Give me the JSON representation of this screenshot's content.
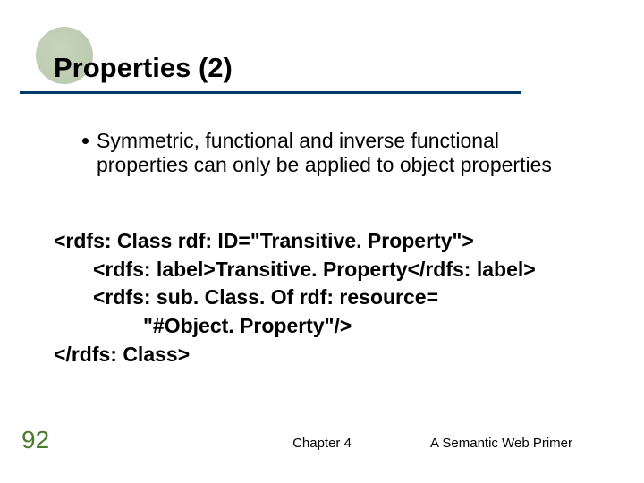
{
  "slide": {
    "title": "Properties (2)",
    "bullet": "Symmetric, functional and inverse functional properties can only be applied to object properties",
    "code": {
      "line1": "<rdfs: Class rdf: ID=\"Transitive. Property\">",
      "line2": "<rdfs: label>Transitive. Property</rdfs: label>",
      "line3": "<rdfs: sub. Class. Of rdf: resource=",
      "line4": "\"#Object. Property\"/>",
      "line5": "</rdfs: Class>"
    },
    "page_number": "92",
    "footer_center": "Chapter 4",
    "footer_right": "A Semantic Web Primer"
  }
}
